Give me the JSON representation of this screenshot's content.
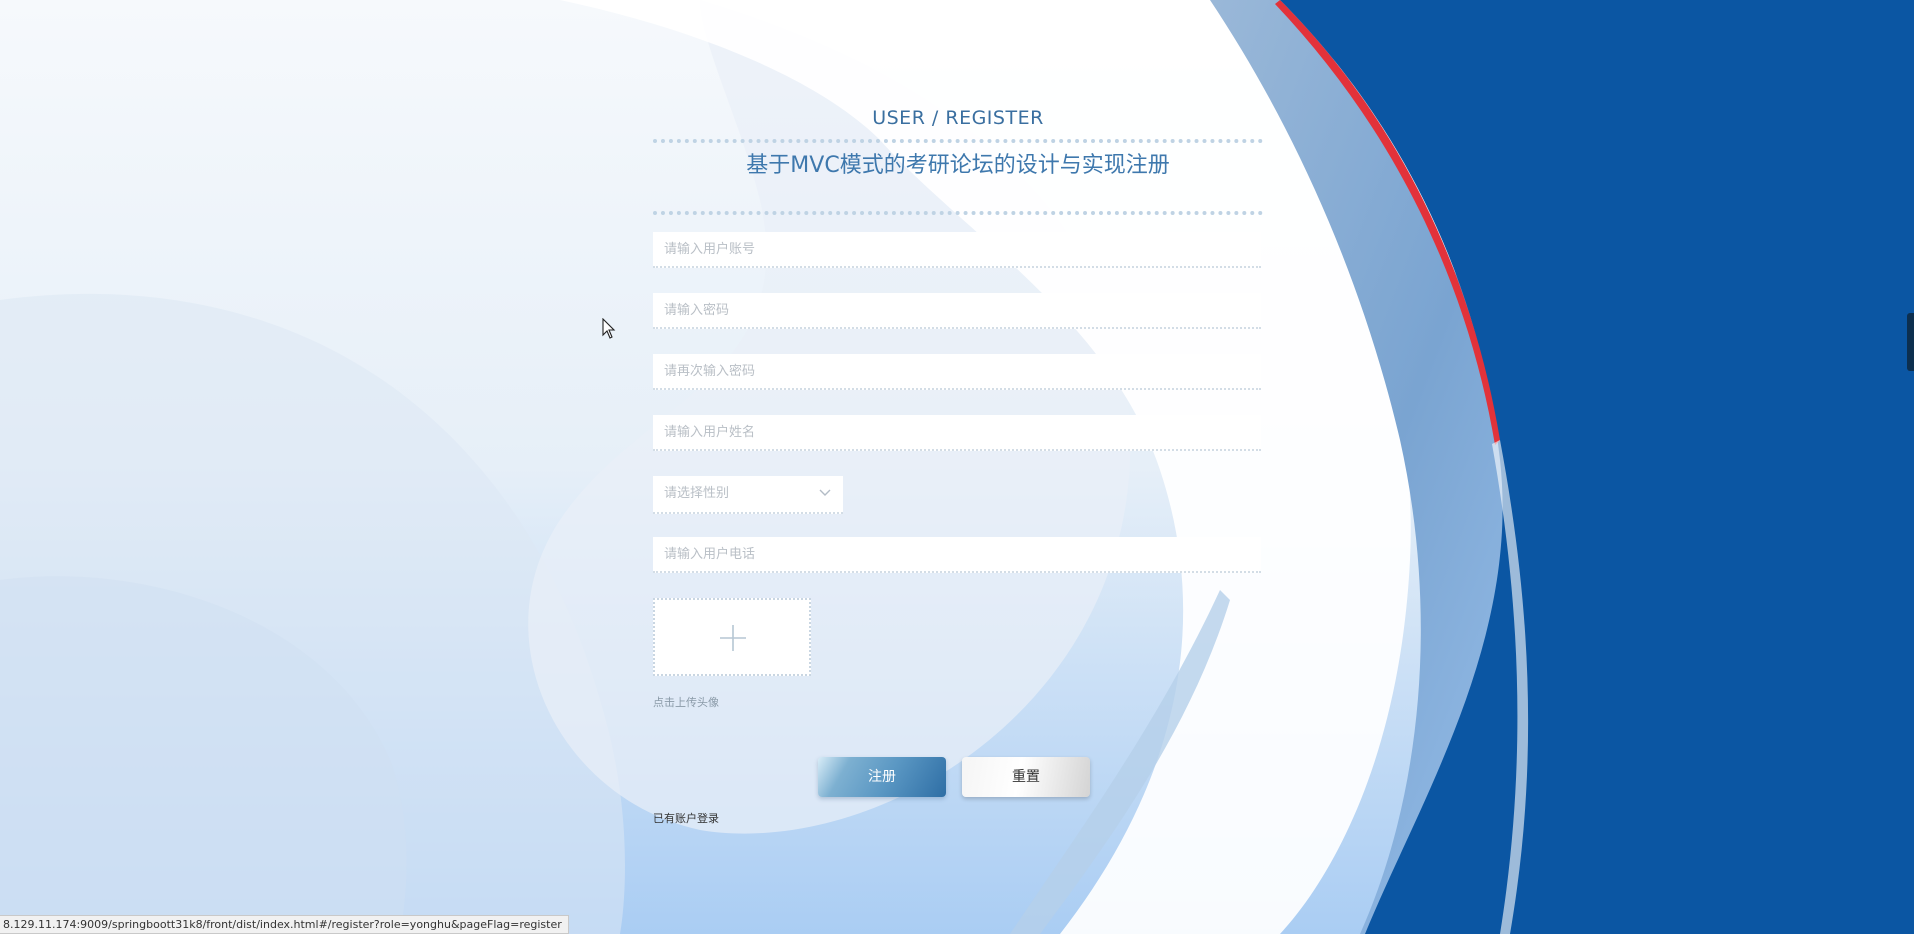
{
  "header": {
    "sub_title": "USER / REGISTER",
    "main_title": "基于MVC模式的考研论坛的设计与实现注册"
  },
  "form": {
    "account_placeholder": "请输入用户账号",
    "password_placeholder": "请输入密码",
    "password_confirm_placeholder": "请再次输入密码",
    "name_placeholder": "请输入用户姓名",
    "gender_placeholder": "请选择性别",
    "phone_placeholder": "请输入用户电话",
    "avatar_hint": "点击上传头像",
    "register_label": "注册",
    "reset_label": "重置",
    "login_link": "已有账户登录"
  },
  "status_bar": {
    "url": "8.129.11.174:9009/springboott31k8/front/dist/index.html#/register?role=yonghu&pageFlag=register"
  },
  "colors": {
    "accent": "#3e78ad",
    "right_panel": "#0b56a3",
    "red_stripe": "#e2323a"
  },
  "icons": {
    "upload": "plus-icon",
    "select": "chevron-down-icon",
    "cursor": "mouse-pointer-icon"
  }
}
